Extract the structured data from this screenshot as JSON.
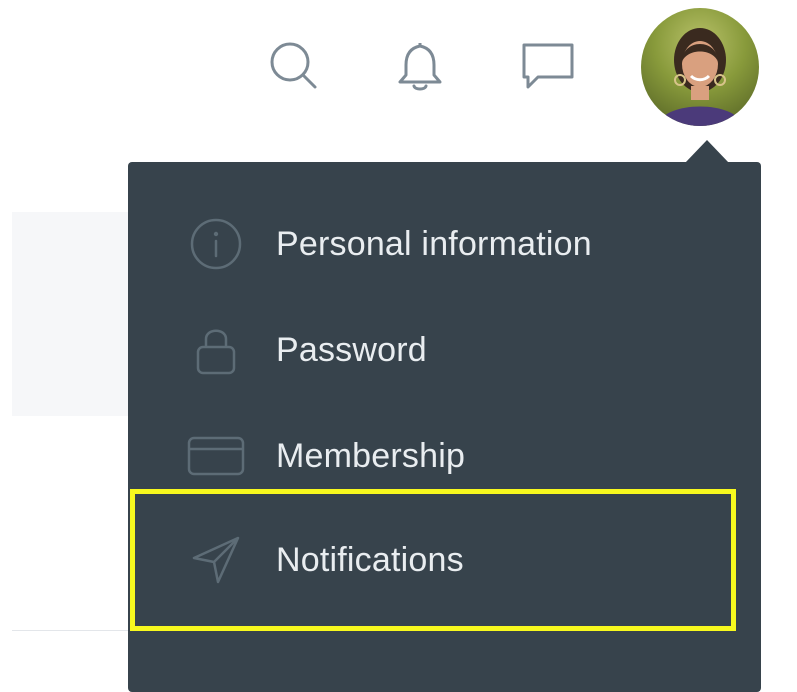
{
  "topbar": {
    "icons": [
      "search-icon",
      "bell-icon",
      "chat-icon"
    ],
    "avatar": "user-avatar"
  },
  "account_menu": {
    "items": [
      {
        "label": "Personal information",
        "icon": "info-icon"
      },
      {
        "label": "Password",
        "icon": "lock-icon"
      },
      {
        "label": "Membership",
        "icon": "card-icon"
      },
      {
        "label": "Notifications",
        "icon": "paper-plane-icon"
      }
    ],
    "highlighted_item": "Notifications"
  },
  "colors": {
    "menu_bg": "#37434c",
    "menu_text": "#e9edf0",
    "icon_stroke": "#5d6c76",
    "highlight": "#f7f91e",
    "topbar_icon": "#7d8a95"
  }
}
